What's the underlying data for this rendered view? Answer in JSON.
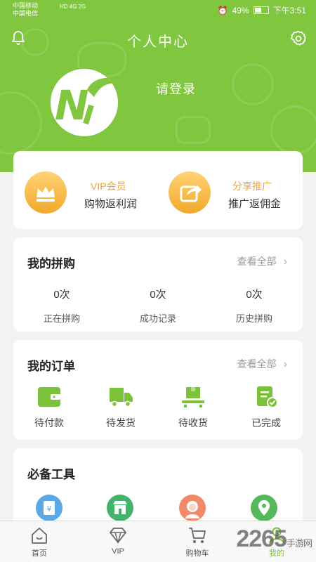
{
  "status": {
    "carrier1": "中国移动",
    "carrier2": "中国电信",
    "network": "HD 4G 2G",
    "battery": "49%",
    "time": "下午3:51"
  },
  "header": {
    "title": "个人中心",
    "login": "请登录",
    "logo_letter": "N"
  },
  "vip": {
    "left_title": "VIP会员",
    "left_sub": "购物返利润",
    "right_title": "分享推广",
    "right_sub": "推广返佣金"
  },
  "group_buy": {
    "title": "我的拼购",
    "see_all": "查看全部",
    "stats": [
      {
        "num": "0次",
        "label": "正在拼购"
      },
      {
        "num": "0次",
        "label": "成功记录"
      },
      {
        "num": "0次",
        "label": "历史拼购"
      }
    ]
  },
  "orders": {
    "title": "我的订单",
    "see_all": "查看全部",
    "items": [
      {
        "label": "待付款",
        "icon": "wallet-icon"
      },
      {
        "label": "待发货",
        "icon": "truck-icon"
      },
      {
        "label": "待收货",
        "icon": "package-icon"
      },
      {
        "label": "已完成",
        "icon": "completed-icon"
      }
    ]
  },
  "tools": {
    "title": "必备工具",
    "icons": [
      "yen-card-icon",
      "store-icon",
      "service-avatar-icon",
      "location-pin-icon"
    ]
  },
  "tabbar": [
    {
      "label": "首页",
      "icon": "home-icon"
    },
    {
      "label": "VIP",
      "icon": "diamond-icon"
    },
    {
      "label": "购物车",
      "icon": "cart-icon"
    },
    {
      "label": "我的",
      "icon": "user-icon"
    }
  ],
  "watermark": {
    "number": "2265",
    "text": "手游网"
  },
  "colors": {
    "brand_green": "#80c63f",
    "vip_orange": "#f0a33a",
    "icon_green": "#7cc13a"
  }
}
